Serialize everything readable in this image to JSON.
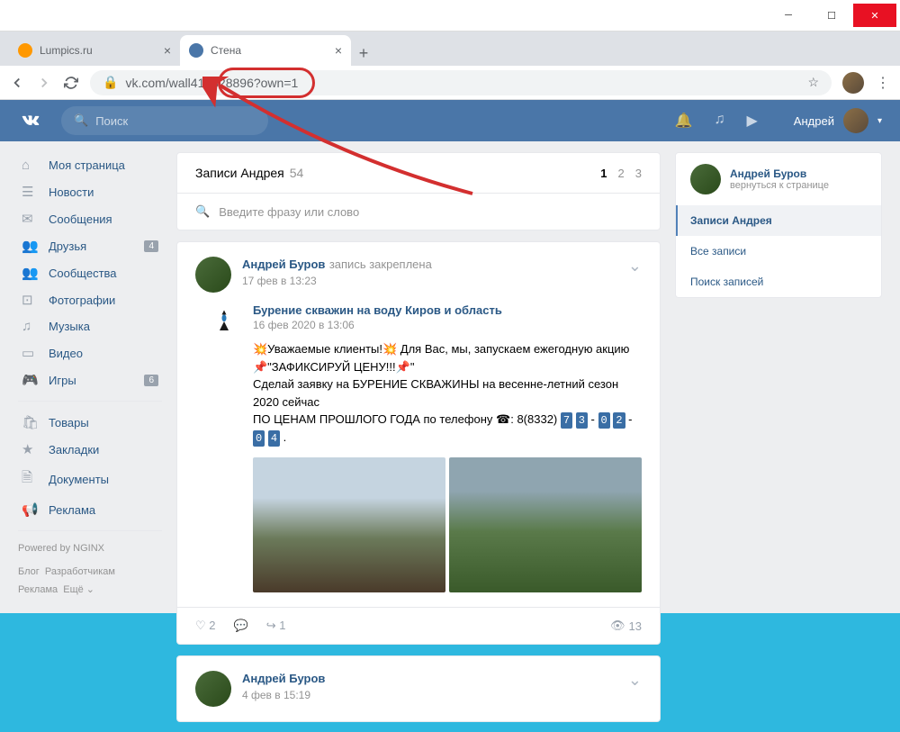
{
  "browser": {
    "tab1": "Lumpics.ru",
    "tab2": "Стена",
    "url": "vk.com/wall413828896?own=1"
  },
  "vk": {
    "search_placeholder": "Поиск",
    "username": "Андрей"
  },
  "sidebar": {
    "items": [
      {
        "icon": "⌂",
        "label": "Моя страница"
      },
      {
        "icon": "☰",
        "label": "Новости"
      },
      {
        "icon": "✉",
        "label": "Сообщения"
      },
      {
        "icon": "👥",
        "label": "Друзья",
        "badge": "4"
      },
      {
        "icon": "👥",
        "label": "Сообщества"
      },
      {
        "icon": "⊡",
        "label": "Фотографии"
      },
      {
        "icon": "♫",
        "label": "Музыка"
      },
      {
        "icon": "▭",
        "label": "Видео"
      },
      {
        "icon": "🎮",
        "label": "Игры",
        "badge": "6"
      }
    ],
    "items2": [
      {
        "icon": "🛍",
        "label": "Товары"
      },
      {
        "icon": "★",
        "label": "Закладки"
      },
      {
        "icon": "🗎",
        "label": "Документы"
      },
      {
        "icon": "📢",
        "label": "Реклама"
      }
    ],
    "powered": "Powered by NGINX",
    "foot1": "Блог",
    "foot2": "Разработчикам",
    "foot3": "Реклама",
    "foot4": "Ещё ⌄"
  },
  "wall": {
    "title": "Записи Андрея",
    "count": "54",
    "page1": "1",
    "page2": "2",
    "page3": "3",
    "search_ph": "Введите фразу или слово"
  },
  "post": {
    "author": "Андрей Буров",
    "pinned": "запись закреплена",
    "date": "17 фев в 13:23",
    "repost_title": "Бурение скважин на воду Киров и область",
    "repost_date": "16 фев 2020 в 13:06",
    "line1": "💥Уважаемые клиенты!💥 Для Вас, мы, запускаем ежегодную акцию",
    "line2": "📌\"ЗАФИКСИРУЙ ЦЕНУ!!!📌\"",
    "line3a": "Сделай заявку на БУРЕНИЕ СКВАЖИНЫ на весенне-летний сезон 2020 сейчас",
    "line3b": "ПО ЦЕНАМ ПРОШЛОГО ГОДА по телефону ☎: 8(8332) ",
    "d1": "7",
    "d2": "3",
    "dd": "-",
    "d3": "0",
    "d4": "2",
    "d5": "0",
    "d6": "4",
    "likes": "2",
    "shares": "1",
    "views": "13"
  },
  "post2": {
    "author": "Андрей Буров",
    "date": "4 фев в 15:19"
  },
  "rb": {
    "name": "Андрей Буров",
    "back": "вернуться к странице",
    "i1": "Записи Андрея",
    "i2": "Все записи",
    "i3": "Поиск записей"
  }
}
